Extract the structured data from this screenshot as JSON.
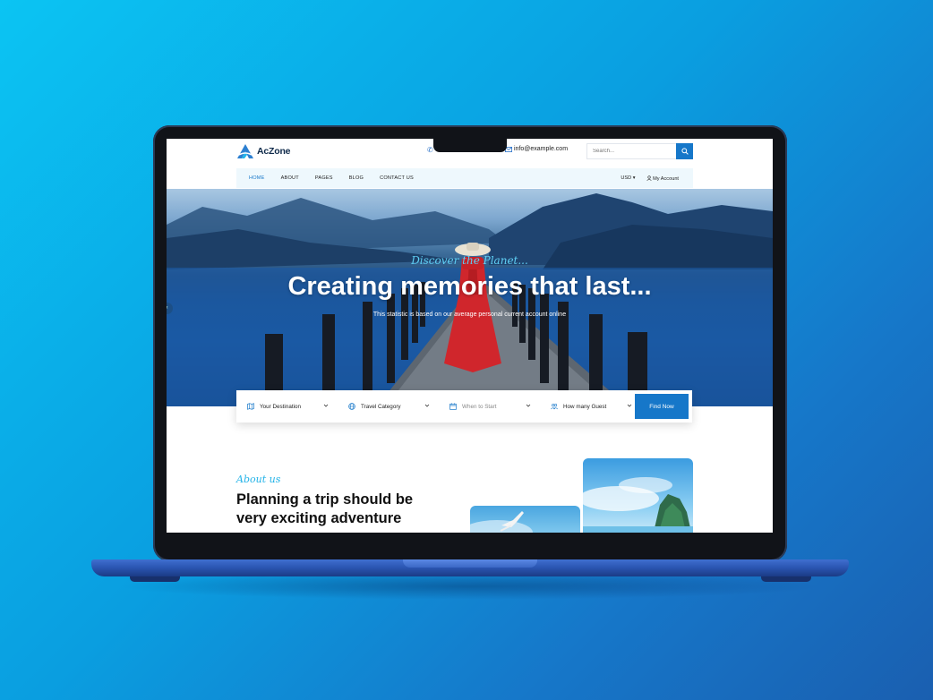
{
  "brand": {
    "name": "AcZone"
  },
  "contact": {
    "email": "info@example.com"
  },
  "search": {
    "placeholder": "Search..."
  },
  "nav": {
    "items": [
      {
        "label": "HOME",
        "active": true
      },
      {
        "label": "ABOUT"
      },
      {
        "label": "PAGES"
      },
      {
        "label": "BLOG"
      },
      {
        "label": "CONTACT US"
      }
    ],
    "currency": "USD",
    "account": "My Account"
  },
  "hero": {
    "subtitle": "Discover the Planet...",
    "title": "Creating memories that last...",
    "description": "This statistic is based on our average personal current account online"
  },
  "booking": {
    "destination": "Your Destination",
    "category": "Travel Category",
    "start": "When to Start",
    "guests": "How many Guest",
    "button": "Find Now"
  },
  "about": {
    "kicker": "About us",
    "title": "Planning a trip should be very exciting adventure"
  },
  "colors": {
    "accent": "#1677c9",
    "kicker": "#23b3e8",
    "nav_bg": "#eef8fd"
  }
}
